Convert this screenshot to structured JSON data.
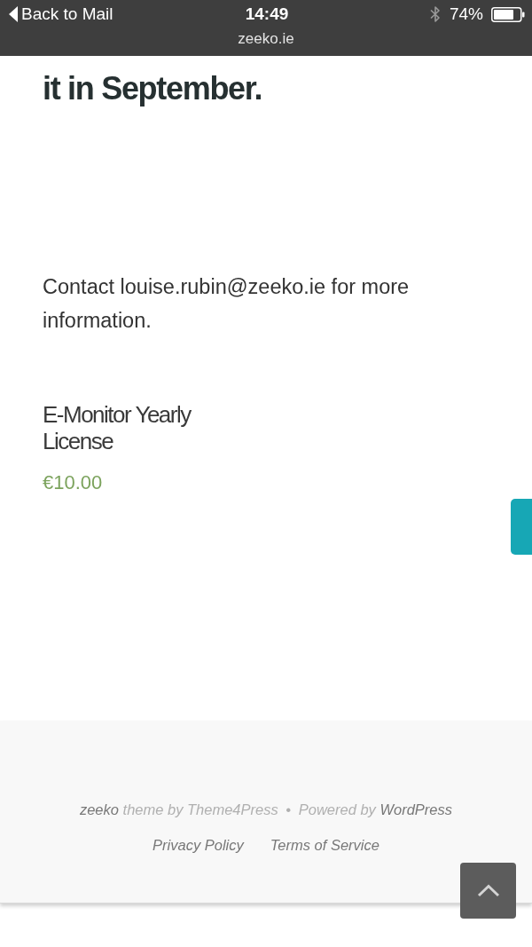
{
  "status_bar": {
    "back_label": "Back to Mail",
    "time": "14:49",
    "battery": "74%"
  },
  "address_bar": {
    "url": "zeeko.ie"
  },
  "article": {
    "heading": "it in September.",
    "body": "Contact louise.rubin@zeeko.ie for more information."
  },
  "product": {
    "title": "E-Monitor Yearly License",
    "price": "€10.00"
  },
  "footer": {
    "credits": [
      {
        "kind": "link",
        "text": "zeeko"
      },
      {
        "kind": "plain",
        "text": "theme by Theme4Press"
      },
      {
        "kind": "separator",
        "text": "•"
      },
      {
        "kind": "plain",
        "text": "Powered by"
      },
      {
        "kind": "link",
        "text": "WordPress"
      }
    ],
    "menu": [
      "Privacy Policy",
      "Terms of Service"
    ]
  }
}
